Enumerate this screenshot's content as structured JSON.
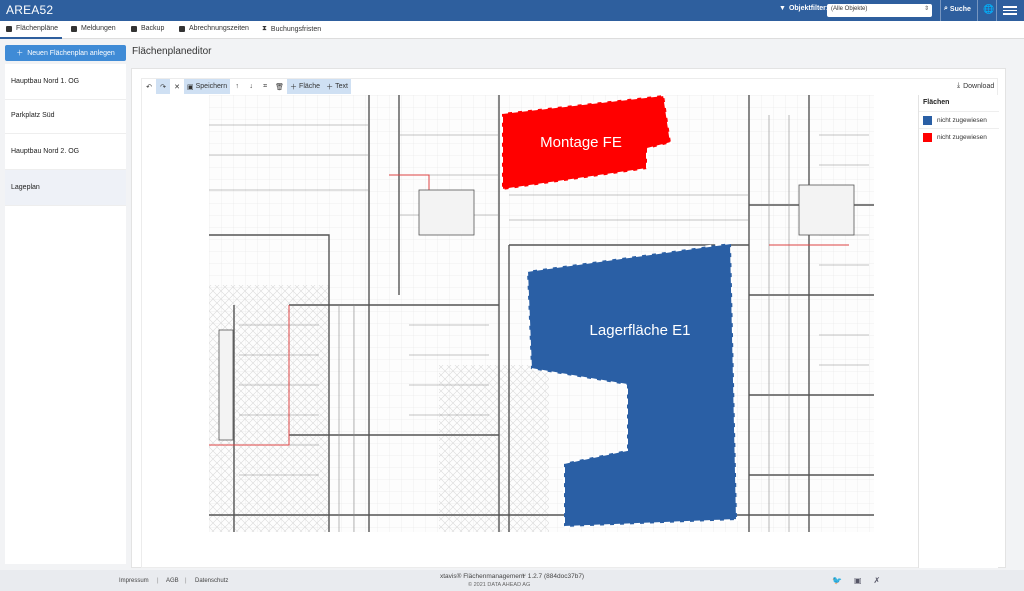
{
  "app": {
    "title": "AREA52"
  },
  "topbar": {
    "filter_label": "Objektfilter:",
    "filter_value": "(Alle Objekte)",
    "search_label": "Suche"
  },
  "tabs": [
    {
      "label": "Flächenpläne",
      "icon": "stack-icon"
    },
    {
      "label": "Meldungen",
      "icon": "message-icon"
    },
    {
      "label": "Backup",
      "icon": "database-icon"
    },
    {
      "label": "Abrechnungszeiten",
      "icon": "document-icon"
    },
    {
      "label": "Buchungsfristen",
      "icon": "hourglass-icon"
    }
  ],
  "sidebar": {
    "new_plan_label": "Neuen Flächenplan anlegen",
    "plans": [
      {
        "label": "Hauptbau Nord 1. OG"
      },
      {
        "label": "Parkplatz Süd"
      },
      {
        "label": "Hauptbau Nord 2. OG"
      },
      {
        "label": "Lageplan"
      }
    ]
  },
  "editor": {
    "title": "Flächenplaneditor",
    "toolbar": {
      "save_label": "Speichern",
      "area_label": "Fläche",
      "text_label": "Text",
      "download_label": "Download"
    },
    "areas": [
      {
        "label": "Montage FE",
        "color": "#ff0000"
      },
      {
        "label": "Lagerfläche E1",
        "color": "#2a5fa5"
      }
    ],
    "legend": {
      "title": "Flächen",
      "items": [
        {
          "label": "nicht zugewiesen",
          "color": "#2a5fa5"
        },
        {
          "label": "nicht zugewiesen",
          "color": "#ff0000"
        }
      ]
    }
  },
  "footer": {
    "links": [
      "Impressum",
      "AGB",
      "Datenschutz"
    ],
    "product": "xtavis® Flächenmanagement",
    "version": "1.2.7 (884doc37b7)",
    "copyright": "© 2021 DATA AHEAD AG"
  }
}
